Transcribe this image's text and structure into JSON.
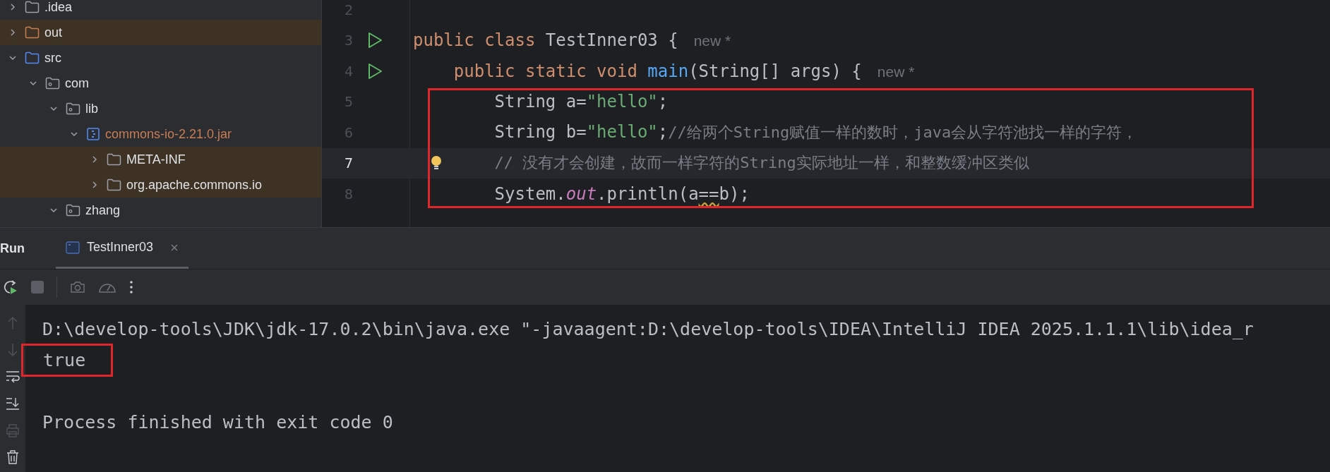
{
  "project_tree": [
    {
      "name": ".idea",
      "kind": "folder",
      "expanded": false,
      "highlighted": false
    },
    {
      "name": "out",
      "kind": "excluded-folder",
      "expanded": false,
      "highlighted": true
    },
    {
      "name": "src",
      "kind": "source-folder",
      "expanded": true,
      "highlighted": false,
      "children": [
        {
          "name": "com",
          "kind": "package",
          "expanded": true,
          "highlighted": false,
          "children": [
            {
              "name": "lib",
              "kind": "package",
              "expanded": true,
              "highlighted": false,
              "children": [
                {
                  "name": "commons-io-2.21.0.jar",
                  "kind": "jar",
                  "expanded": true,
                  "highlighted": false,
                  "children": [
                    {
                      "name": "META-INF",
                      "kind": "folder",
                      "expanded": false,
                      "highlighted": true
                    },
                    {
                      "name": "org.apache.commons.io",
                      "kind": "folder",
                      "expanded": false,
                      "highlighted": true
                    }
                  ]
                }
              ]
            },
            {
              "name": "zhang",
              "kind": "package",
              "expanded": true,
              "highlighted": false
            }
          ]
        }
      ]
    }
  ],
  "editor": {
    "lines": [
      {
        "number": "2",
        "current": false
      },
      {
        "number": "3",
        "current": false,
        "marker": {
          "kind": "run"
        },
        "hint": "new *",
        "tokens": [
          {
            "text": "public class ",
            "kind": "keyword"
          },
          {
            "text": "TestInner03 {",
            "kind": "plain"
          }
        ]
      },
      {
        "number": "4",
        "current": false,
        "marker": {
          "kind": "run"
        },
        "hint": "new *",
        "tokens": [
          {
            "text": "    public static void ",
            "kind": "keyword"
          },
          {
            "text": "main",
            "kind": "method"
          },
          {
            "text": "(String[] args) {",
            "kind": "plain"
          }
        ]
      },
      {
        "number": "5",
        "current": false,
        "boxed": true,
        "tokens": [
          {
            "text": "        String a=",
            "kind": "plain"
          },
          {
            "text": "\"hello\"",
            "kind": "string"
          },
          {
            "text": ";",
            "kind": "plain"
          }
        ]
      },
      {
        "number": "6",
        "current": false,
        "boxed": true,
        "tokens": [
          {
            "text": "        String b=",
            "kind": "plain"
          },
          {
            "text": "\"hello\"",
            "kind": "string"
          },
          {
            "text": ";",
            "kind": "plain"
          },
          {
            "text": "//给两个String赋值一样的数时，java会从字符池找一样的字符，",
            "kind": "comment"
          }
        ]
      },
      {
        "number": "7",
        "current": true,
        "marker": {
          "kind": "bulb"
        },
        "boxed": true,
        "tokens": [
          {
            "text": "        // 没有才会创建，故而一样字符的String实际地址一样，和整数缓冲区类似",
            "kind": "comment"
          }
        ]
      },
      {
        "number": "8",
        "current": false,
        "boxed": true,
        "tokens": [
          {
            "text": "        System.",
            "kind": "plain"
          },
          {
            "text": "out",
            "kind": "field"
          },
          {
            "text": ".println(a",
            "kind": "plain"
          },
          {
            "text": "==",
            "kind": "warning"
          },
          {
            "text": "b);",
            "kind": "plain"
          }
        ]
      }
    ]
  },
  "run_panel": {
    "title": "Run",
    "tabs": [
      {
        "label": "TestInner03",
        "selected": true
      }
    ],
    "console": [
      {
        "text": "D:\\develop-tools\\JDK\\jdk-17.0.2\\bin\\java.exe \"-javaagent:D:\\develop-tools\\IDEA\\IntelliJ IDEA 2025.1.1.1\\lib\\idea_r",
        "boxed": false,
        "blank_line_before": false
      },
      {
        "text": "true",
        "boxed": true,
        "blank_line_before": false
      },
      {
        "text": "Process finished with exit code 0",
        "boxed": false,
        "blank_line_before": true
      }
    ]
  }
}
